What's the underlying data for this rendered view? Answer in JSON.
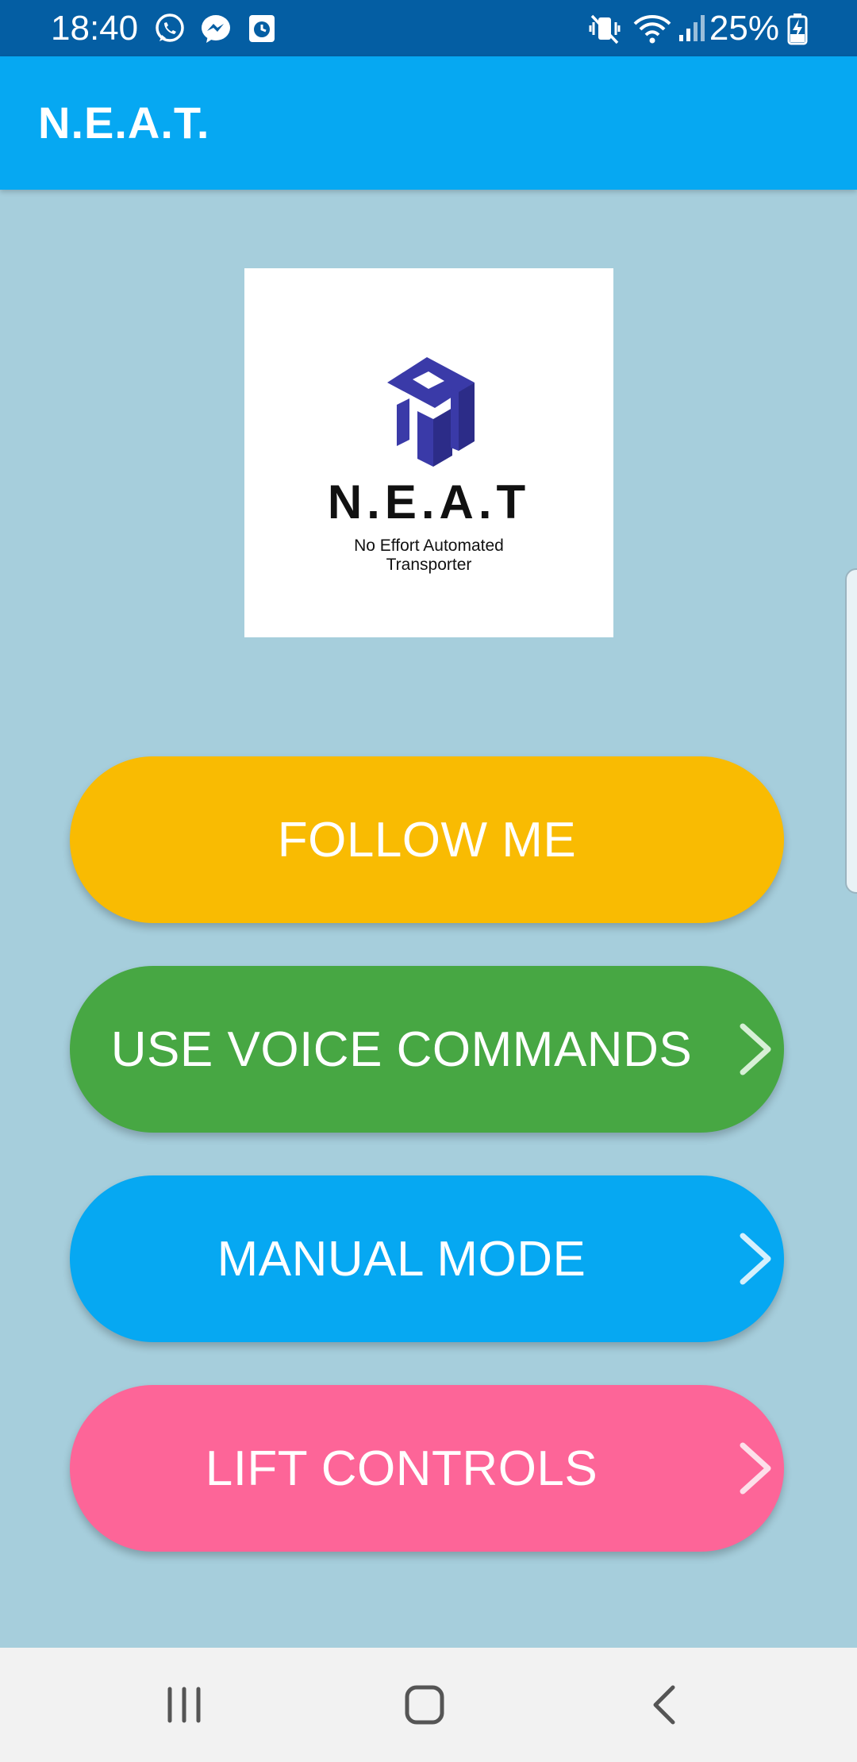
{
  "status_bar": {
    "time": "18:40",
    "battery_percent": "25%",
    "notification_icons": [
      "whatsapp-icon",
      "messenger-icon",
      "clock-app-icon"
    ],
    "system_icons": [
      "mute-vibrate-icon",
      "wifi-icon",
      "signal-icon",
      "battery-charging-icon"
    ]
  },
  "app_bar": {
    "title": "N.E.A.T."
  },
  "logo": {
    "title": "N.E.A.T",
    "subtitle_line1": "No Effort Automated",
    "subtitle_line2": "Transporter",
    "mark_color": "#3a3aa8"
  },
  "buttons": [
    {
      "label": "FOLLOW ME",
      "color": "#f9bb02",
      "has_chevron": false
    },
    {
      "label": "USE VOICE COMMANDS",
      "color": "#47a743",
      "has_chevron": true
    },
    {
      "label": "MANUAL MODE",
      "color": "#06a8f2",
      "has_chevron": true
    },
    {
      "label": "LIFT CONTROLS",
      "color": "#fd6598",
      "has_chevron": true
    }
  ],
  "nav_bar": {
    "items": [
      "recents-icon",
      "home-icon",
      "back-icon"
    ]
  },
  "colors": {
    "status_bar": "#045ea3",
    "app_bar": "#06a8f2",
    "background": "#a6cedc",
    "nav_bar": "#f2f2f2"
  }
}
